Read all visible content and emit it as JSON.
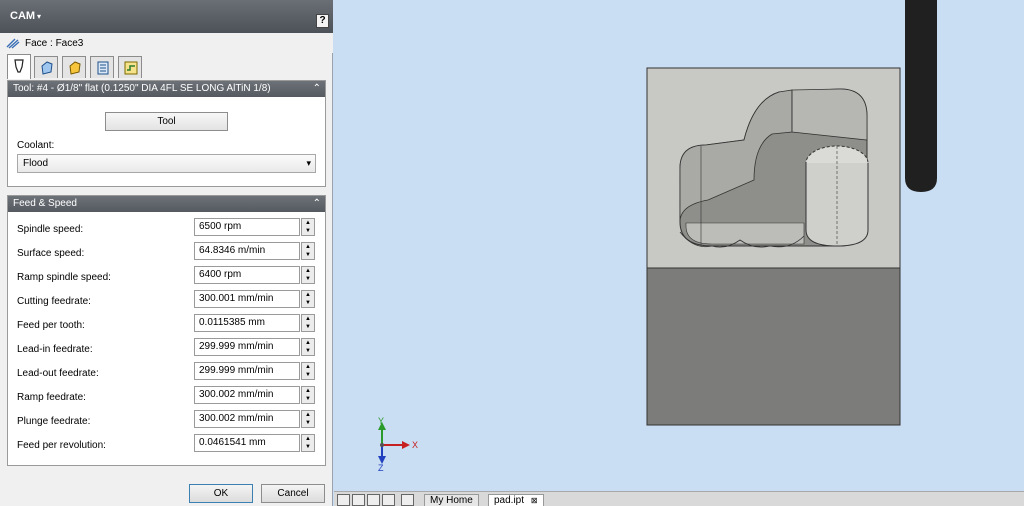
{
  "panel": {
    "title": "CAM",
    "title_caret": "▾",
    "help": "?",
    "face_label": "Face : Face3",
    "tabs": [
      {
        "name": "tool-tab",
        "icon": "tool-holder-icon",
        "active": true
      },
      {
        "name": "geometry-tab",
        "icon": "geometry-icon",
        "active": false
      },
      {
        "name": "heights-tab",
        "icon": "heights-icon",
        "active": false
      },
      {
        "name": "passes-tab",
        "icon": "passes-icon",
        "active": false
      },
      {
        "name": "linking-tab",
        "icon": "linking-icon",
        "active": false
      }
    ]
  },
  "tool_section": {
    "header": "Tool: #4 - Ø1/8\" flat (0.1250\" DIA 4FL SE LONG AlTiN 1/8)",
    "collapse": "⌃",
    "tool_button": "Tool",
    "coolant_label": "Coolant:",
    "coolant_value": "Flood",
    "coolant_arrow": "▾"
  },
  "feed_section": {
    "header": "Feed & Speed",
    "collapse": "⌃",
    "params": [
      {
        "label": "Spindle speed:",
        "value": "6500 rpm"
      },
      {
        "label": "Surface speed:",
        "value": "64.8346 m/min"
      },
      {
        "label": "Ramp spindle speed:",
        "value": "6400 rpm"
      },
      {
        "label": "Cutting feedrate:",
        "value": "300.001 mm/min"
      },
      {
        "label": "Feed per tooth:",
        "value": "0.0115385 mm"
      },
      {
        "label": "Lead-in feedrate:",
        "value": "299.999 mm/min"
      },
      {
        "label": "Lead-out feedrate:",
        "value": "299.999 mm/min"
      },
      {
        "label": "Ramp feedrate:",
        "value": "300.002 mm/min"
      },
      {
        "label": "Plunge feedrate:",
        "value": "300.002 mm/min"
      },
      {
        "label": "Feed per revolution:",
        "value": "0.0461541 mm"
      }
    ]
  },
  "buttons": {
    "ok": "OK",
    "cancel": "Cancel"
  },
  "viewport": {
    "axis_x": "X",
    "axis_y": "Y",
    "axis_z": "Z",
    "colors": {
      "background": "#c9ddf3",
      "stock_top": "#c8c8c4",
      "stock_side": "#7c7c7a",
      "tool": "#202020"
    }
  },
  "bottom_bar": {
    "tabs": [
      {
        "label": "My Home",
        "active": false
      },
      {
        "label": "pad.ipt",
        "active": true
      }
    ],
    "close": "⊠"
  }
}
